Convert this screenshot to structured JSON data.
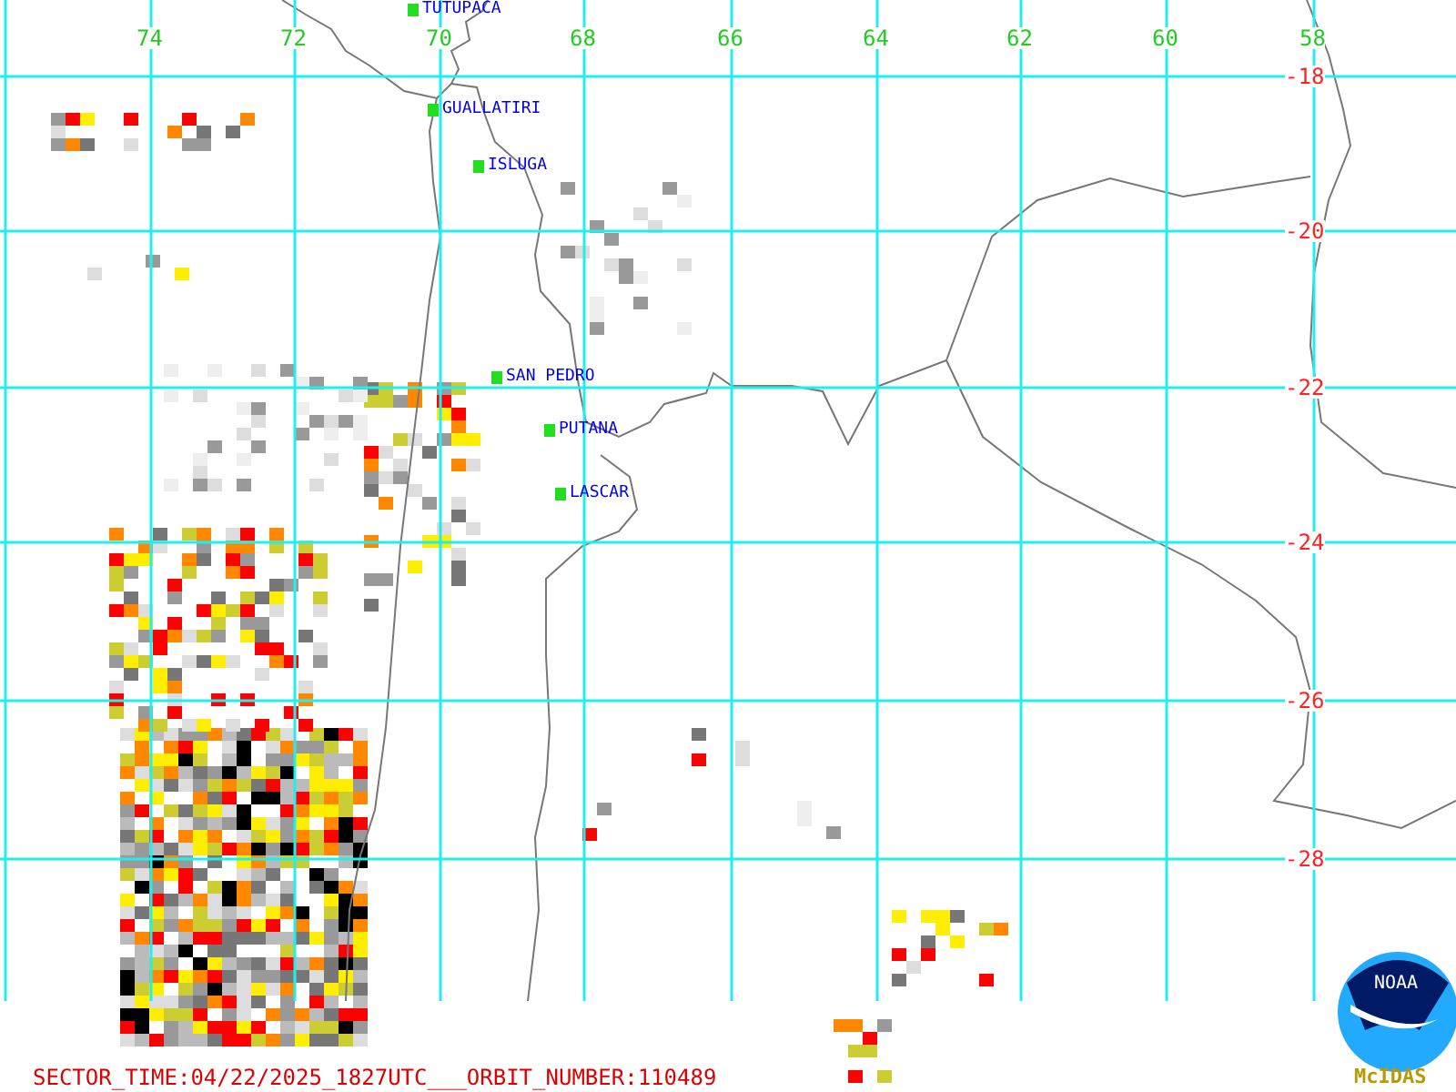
{
  "longitude_labels": [
    "74",
    "72",
    "70",
    "68",
    "66",
    "64",
    "62",
    "60",
    "58"
  ],
  "latitude_labels": [
    "-18",
    "-20",
    "-22",
    "-24",
    "-26",
    "-28"
  ],
  "volcanoes": [
    {
      "name": "TUTUPACA"
    },
    {
      "name": "GUALLATIRI"
    },
    {
      "name": "ISLUGA"
    },
    {
      "name": "SAN PEDRO"
    },
    {
      "name": "PUTANA"
    },
    {
      "name": "LASCAR"
    }
  ],
  "footer": "SECTOR_TIME:04/22/2025_1827UTC___ORBIT_NUMBER:110489",
  "logo": {
    "text": "NOAA",
    "caption": "McIDAS"
  }
}
